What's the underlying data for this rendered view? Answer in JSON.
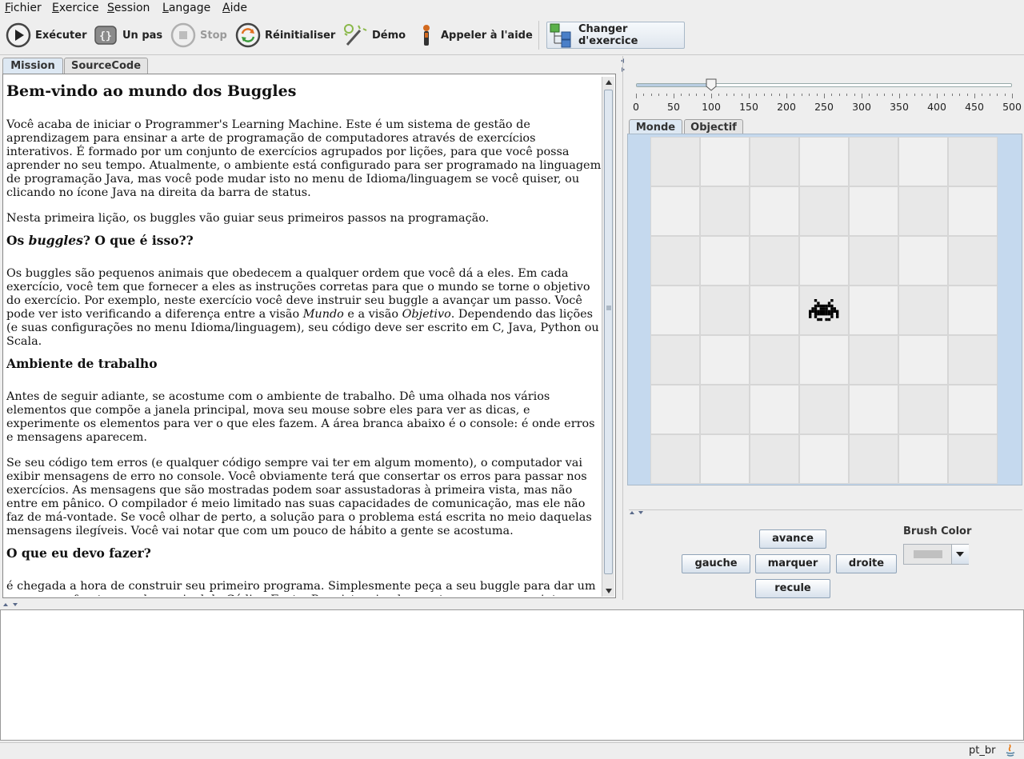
{
  "menu": [
    {
      "mnemonic": "F",
      "rest": "ichier"
    },
    {
      "mnemonic": "E",
      "rest": "xercice"
    },
    {
      "mnemonic": "S",
      "rest": "ession"
    },
    {
      "mnemonic": "L",
      "rest": "angage"
    },
    {
      "mnemonic": "A",
      "rest": "ide"
    }
  ],
  "toolbar": {
    "execute": "Exécuter",
    "step": "Un pas",
    "stop": "Stop",
    "reset": "Réinitialiser",
    "demo": "Démo",
    "help": "Appeler à l'aide",
    "change": "Changer d'exercice"
  },
  "left_tabs": [
    "Mission",
    "SourceCode"
  ],
  "mission": {
    "title": "Bem-vindo ao mundo dos Buggles",
    "p1": "Você acaba de iniciar o Programmer's Learning Machine. Este é um sistema de gestão de aprendizagem para ensinar a arte de programação de computadores através de exercícios interativos. É formado por um conjunto de exercícios agrupados por lições, para que você possa aprender no seu tempo. Atualmente, o ambiente está configurado para ser programado na linguagem de programação Java, mas você pode mudar isto no menu de Idioma/linguagem se você quiser, ou clicando no ícone Java na direita da barra de status.",
    "p2": "Nesta primeira lição, os buggles vão guiar seus primeiros passos na programação.",
    "h2a_pre": "Os ",
    "h2a_em": "buggles",
    "h2a_post": "? O que é isso??",
    "p3_a": "Os buggles são pequenos animais que obedecem a qualquer ordem que você dá a eles. Em cada exercício, você tem que fornecer a eles as instruções corretas para que o mundo se torne o objetivo do exercício. Por exemplo, neste exercício você deve instruir seu buggle a avançar um passo. Você pode ver isto verificando a diferença entre a visão ",
    "p3_em1": "Mundo",
    "p3_b": " e a visão ",
    "p3_em2": "Objetivo",
    "p3_c": ". Dependendo das lições (e suas configurações no menu Idioma/linguagem), seu código deve ser escrito em C, Java, Python ou Scala.",
    "h2b": "Ambiente de trabalho",
    "p4": "Antes de seguir adiante, se acostume com o ambiente de trabalho. Dê uma olhada nos vários elementos que compõe a janela principal, mova seu mouse sobre eles para ver as dicas, e experimente os elementos para ver o que eles fazem. A área branca abaixo é o console: é onde erros e mensagens aparecem.",
    "p5": "Se seu código tem erros (e qualquer código sempre vai ter em algum momento), o computador vai exibir mensagens de erro no console. Você obviamente terá que consertar os erros para passar nos exercícios. As mensagens que são mostradas podem soar assustadoras à primeira vista, mas não entre em pânico. O compilador é meio limitado nas suas capacidades de comunicação, mas ele não faz de má-vontade. Se você olhar de perto, a solução para o problema está escrita no meio daquelas mensagens ilegíveis. Você vai notar que com um pouco de hábito a gente se acostuma.",
    "h2c": "O que eu devo fazer?",
    "p6": "é chegada a hora de construir seu primeiro programa. Simplesmente peça a seu buggle para dar um passo para frente usando o painel de Código Fonte. Para isto, simplesmente escreva o seguinte código (clicar nos controles iterativos não é o suficiente; você tem que escrever o código e depois experimentar"
  },
  "slider": {
    "value": 100,
    "min": 0,
    "max": 500,
    "labels": [
      "0",
      "50",
      "100",
      "150",
      "200",
      "250",
      "300",
      "350",
      "400",
      "450",
      "500"
    ]
  },
  "right_tabs": [
    "Monde",
    "Objectif"
  ],
  "world": {
    "columns": 7,
    "rows": 7,
    "buggle": {
      "col": 3,
      "row": 3
    }
  },
  "controls": {
    "forward": "avance",
    "left": "gauche",
    "mark": "marquer",
    "right": "droite",
    "back": "recule",
    "brush_label": "Brush Color"
  },
  "status": {
    "locale": "pt_br"
  },
  "colors": {
    "world_background": "#c5d9ee",
    "cell_light": "#f0f0f0",
    "cell_dark": "#e8e8e8",
    "buggle": "#000000"
  }
}
